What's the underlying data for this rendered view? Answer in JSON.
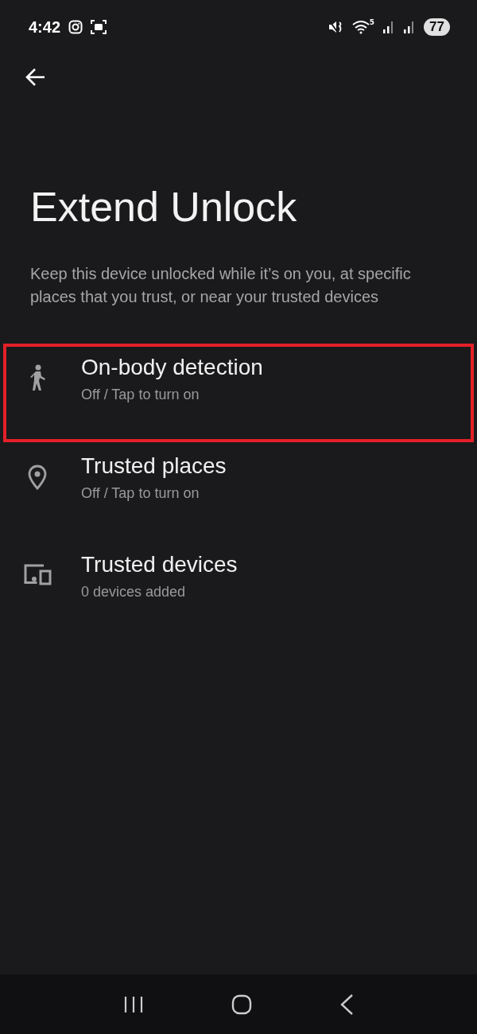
{
  "status_bar": {
    "time": "4:42",
    "wifi_badge": "5",
    "battery": "77"
  },
  "title": "Extend Unlock",
  "description": "Keep this device unlocked while it’s on you, at specific places that you trust, or near your trusted devices",
  "items": [
    {
      "kind": "walk",
      "title": "On-body detection",
      "subtitle": "Off / Tap to turn on",
      "highlighted": true
    },
    {
      "kind": "place",
      "title": "Trusted places",
      "subtitle": "Off / Tap to turn on",
      "highlighted": false
    },
    {
      "kind": "devices",
      "title": "Trusted devices",
      "subtitle": "0 devices added",
      "highlighted": false
    }
  ]
}
